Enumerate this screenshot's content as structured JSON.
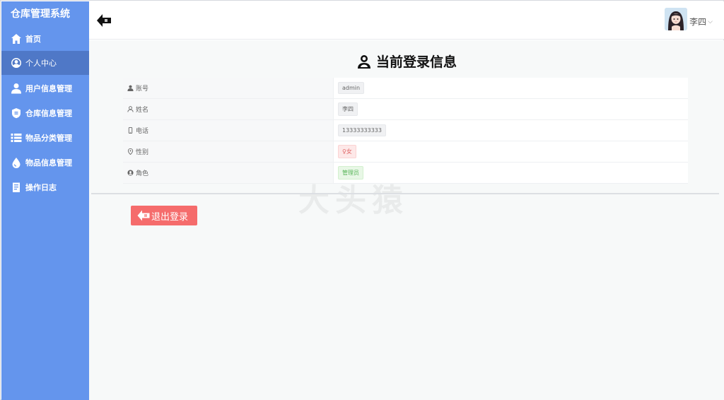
{
  "sidebar": {
    "brand": "仓库管理系统",
    "items": [
      {
        "label": "首页",
        "icon": "home-icon"
      },
      {
        "label": "个人中心",
        "icon": "user-center-icon",
        "active": true
      },
      {
        "label": "用户信息管理",
        "icon": "user-manage-icon"
      },
      {
        "label": "仓库信息管理",
        "icon": "warehouse-icon"
      },
      {
        "label": "物品分类管理",
        "icon": "list-icon"
      },
      {
        "label": "物品信息管理",
        "icon": "drop-icon"
      },
      {
        "label": "操作日志",
        "icon": "log-icon"
      }
    ]
  },
  "header": {
    "user_name": "李四"
  },
  "page": {
    "title": "当前登录信息",
    "watermark": "大头猿"
  },
  "info": {
    "rows": [
      {
        "label": "账号",
        "value": "admin"
      },
      {
        "label": "姓名",
        "value": "李四"
      },
      {
        "label": "电话",
        "value": "13333333333"
      },
      {
        "label": "性别",
        "value": "♀女"
      },
      {
        "label": "角色",
        "value": "管理员"
      }
    ]
  },
  "actions": {
    "logout_label": "退出登录"
  },
  "colors": {
    "sidebar": "#6495ed",
    "sidebar_active": "#4f78c7",
    "danger": "#f56c6c",
    "success_tag": "#59b55a"
  }
}
